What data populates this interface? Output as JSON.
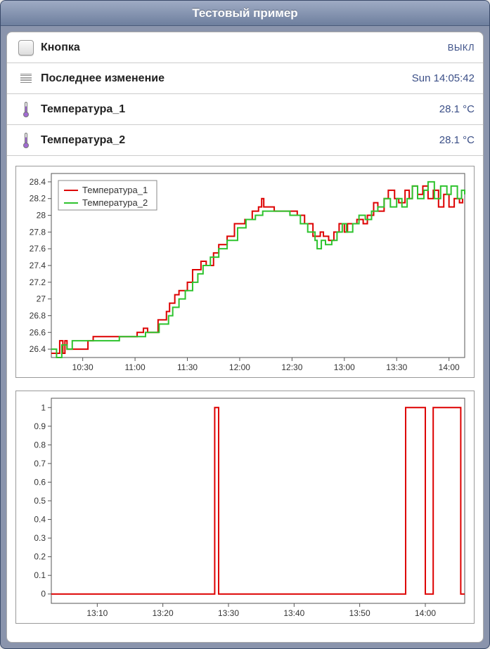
{
  "header": {
    "title": "Тестовый пример"
  },
  "rows": {
    "button": {
      "label": "Кнопка",
      "value": "ВЫКЛ"
    },
    "lastchange": {
      "label": "Последнее изменение",
      "value": "Sun 14:05:42"
    },
    "temp1": {
      "label": "Температура_1",
      "value": "28.1 °C"
    },
    "temp2": {
      "label": "Температура_2",
      "value": "28.1 °C"
    }
  },
  "legend": {
    "s1": "Температура_1",
    "s2": "Температура_2"
  },
  "chart_data": [
    {
      "type": "line",
      "title": "",
      "xlabel": "",
      "ylabel": "",
      "ylim": [
        26.3,
        28.5
      ],
      "xlim": [
        10.2,
        14.15
      ],
      "x_ticks_labels": [
        "10:30",
        "11:00",
        "11:30",
        "12:00",
        "12:30",
        "13:00",
        "13:30",
        "14:00"
      ],
      "x_ticks": [
        10.5,
        11.0,
        11.5,
        12.0,
        12.5,
        13.0,
        13.5,
        14.0
      ],
      "y_ticks": [
        26.4,
        26.6,
        26.8,
        27.0,
        27.2,
        27.4,
        27.6,
        27.8,
        28.0,
        28.2,
        28.4
      ],
      "series": [
        {
          "name": "Температура_1",
          "color": "#d00",
          "x": [
            10.2,
            10.28,
            10.31,
            10.33,
            10.35,
            10.55,
            10.6,
            10.9,
            11.02,
            11.08,
            11.12,
            11.2,
            11.22,
            11.3,
            11.33,
            11.38,
            11.42,
            11.5,
            11.55,
            11.63,
            11.68,
            11.75,
            11.8,
            11.88,
            11.95,
            12.05,
            12.12,
            12.18,
            12.21,
            12.23,
            12.27,
            12.33,
            12.45,
            12.55,
            12.62,
            12.7,
            12.73,
            12.77,
            12.8,
            12.85,
            12.9,
            12.95,
            13.0,
            13.03,
            13.08,
            13.12,
            13.18,
            13.22,
            13.28,
            13.32,
            13.38,
            13.42,
            13.48,
            13.52,
            13.58,
            13.62,
            13.65,
            13.7,
            13.75,
            13.8,
            13.85,
            13.9,
            13.95,
            14.0,
            14.05,
            14.1,
            14.13
          ],
          "y": [
            26.35,
            26.5,
            26.35,
            26.5,
            26.4,
            26.5,
            26.55,
            26.55,
            26.6,
            26.65,
            26.6,
            26.6,
            26.75,
            26.85,
            26.95,
            27.05,
            27.1,
            27.2,
            27.35,
            27.45,
            27.4,
            27.55,
            27.65,
            27.75,
            27.9,
            27.95,
            28.05,
            28.1,
            28.2,
            28.1,
            28.1,
            28.05,
            28.05,
            28.0,
            27.9,
            27.75,
            27.75,
            27.8,
            27.75,
            27.7,
            27.8,
            27.9,
            27.8,
            27.9,
            27.9,
            27.95,
            27.9,
            28.0,
            28.15,
            28.05,
            28.2,
            28.3,
            28.2,
            28.15,
            28.3,
            28.2,
            28.35,
            28.25,
            28.35,
            28.2,
            28.3,
            28.1,
            28.25,
            28.1,
            28.2,
            28.15,
            28.2
          ]
        },
        {
          "name": "Температура_2",
          "color": "#2ec32e",
          "x": [
            10.2,
            10.25,
            10.3,
            10.35,
            10.4,
            10.6,
            10.85,
            11.0,
            11.1,
            11.2,
            11.23,
            11.32,
            11.36,
            11.42,
            11.48,
            11.55,
            11.6,
            11.65,
            11.72,
            11.8,
            11.88,
            11.98,
            12.06,
            12.15,
            12.22,
            12.35,
            12.48,
            12.58,
            12.65,
            12.72,
            12.74,
            12.78,
            12.82,
            12.88,
            12.93,
            12.98,
            13.02,
            13.08,
            13.14,
            13.2,
            13.26,
            13.32,
            13.38,
            13.44,
            13.5,
            13.55,
            13.6,
            13.65,
            13.7,
            13.76,
            13.8,
            13.86,
            13.92,
            13.98,
            14.02,
            14.08,
            14.12,
            14.15
          ],
          "y": [
            26.4,
            26.3,
            26.45,
            26.4,
            26.5,
            26.5,
            26.55,
            26.55,
            26.6,
            26.6,
            26.7,
            26.8,
            26.9,
            27.0,
            27.1,
            27.2,
            27.3,
            27.4,
            27.5,
            27.6,
            27.7,
            27.85,
            27.95,
            28.0,
            28.05,
            28.05,
            28.0,
            27.9,
            27.8,
            27.7,
            27.6,
            27.7,
            27.65,
            27.7,
            27.8,
            27.9,
            27.8,
            27.9,
            28.0,
            27.95,
            28.05,
            28.1,
            28.2,
            28.1,
            28.2,
            28.1,
            28.2,
            28.35,
            28.2,
            28.3,
            28.4,
            28.2,
            28.35,
            28.25,
            28.35,
            28.2,
            28.3,
            28.25
          ]
        }
      ],
      "legend_pos": "upper-left"
    },
    {
      "type": "line",
      "title": "",
      "xlabel": "",
      "ylabel": "",
      "ylim": [
        -0.05,
        1.05
      ],
      "xlim": [
        13.05,
        14.1
      ],
      "x_ticks_labels": [
        "13:10",
        "13:20",
        "13:30",
        "13:40",
        "13:50",
        "14:00"
      ],
      "x_ticks": [
        13.1667,
        13.3333,
        13.5,
        13.6667,
        13.8333,
        14.0
      ],
      "y_ticks": [
        0,
        0.1,
        0.2,
        0.3,
        0.4,
        0.5,
        0.6,
        0.7,
        0.8,
        0.9,
        1.0
      ],
      "series": [
        {
          "name": "",
          "color": "#d00",
          "x": [
            13.05,
            13.465,
            13.465,
            13.475,
            13.475,
            13.95,
            13.95,
            14.0,
            14.0,
            14.02,
            14.02,
            14.09,
            14.09,
            14.1
          ],
          "y": [
            0,
            0,
            1,
            1,
            0,
            0,
            1,
            1,
            0,
            0,
            1,
            1,
            0,
            0
          ]
        }
      ]
    }
  ]
}
